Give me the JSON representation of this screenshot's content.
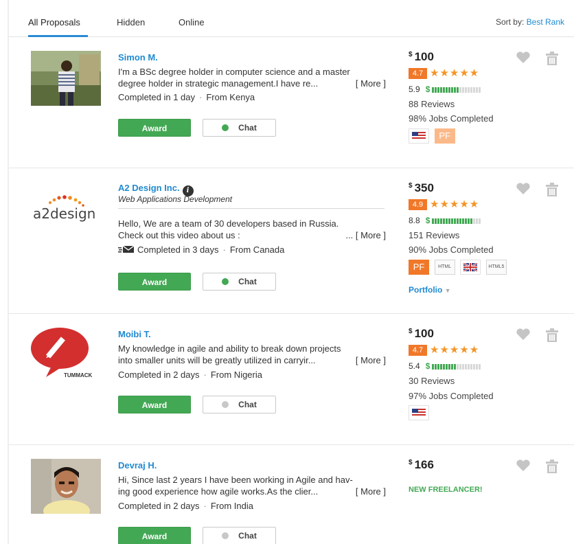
{
  "tabs": [
    {
      "label": "All Proposals",
      "active": true
    },
    {
      "label": "Hidden",
      "active": false
    },
    {
      "label": "Online",
      "active": false
    }
  ],
  "sort": {
    "label": "Sort by:",
    "value": "Best Rank"
  },
  "buttons": {
    "award": "Award",
    "chat": "Chat",
    "more": "[ More ]"
  },
  "proposals": [
    {
      "name": "Simon M.",
      "desc1": "I'm a BSc degree holder in computer science and a master",
      "desc2": "degree holder in strategic management.I have re...",
      "completed": "Completed in 1 day",
      "from": "From Kenya",
      "currency": "$",
      "price": "100",
      "rating": "4.7",
      "earnings": "5.9",
      "earnings_level": 0.55,
      "reviews": "88 Reviews",
      "jobs": "98% Jobs Completed",
      "badges": [
        "us-flag",
        "PF"
      ],
      "chat_online": true
    },
    {
      "name": "A2 Design Inc.",
      "verified_icon": "verified-badge-icon",
      "verified_glyph": "i",
      "subtitle": "Web Applications Development",
      "desc1": "Hello, We are a team of 30 developers based in Russia.",
      "desc2": "Check out this video about us :",
      "desc2_suffix": "...",
      "completed": "Completed in 3 days",
      "from": "From Canada",
      "currency": "$",
      "price": "350",
      "rating": "4.9",
      "earnings": "8.8",
      "earnings_level": 0.85,
      "reviews": "151 Reviews",
      "jobs": "90% Jobs Completed",
      "badges": [
        "PF",
        "HTML",
        "uk-flag",
        "HTML5"
      ],
      "portfolio": "Portfolio",
      "chat_online": true
    },
    {
      "name": "Moibi T.",
      "desc1": "My knowledge in agile and ability to break down projects",
      "desc2": "into smaller units will be greatly utilized in carryir...",
      "completed": "Completed in 2 days",
      "from": "From Nigeria",
      "currency": "$",
      "price": "100",
      "rating": "4.7",
      "earnings": "5.4",
      "earnings_level": 0.5,
      "reviews": "30 Reviews",
      "jobs": "97% Jobs Completed",
      "badges": [
        "us-flag"
      ],
      "logo_text": "TUMMACK",
      "chat_online": false
    },
    {
      "name": "Devraj H.",
      "desc1": "Hi, Since last 2 years I have been working in Agile and hav-",
      "desc2": "ing good experience how agile works.As the clier...",
      "completed": "Completed in 2 days",
      "from": "From India",
      "currency": "$",
      "price": "166",
      "new_freelancer": "NEW FREELANCER!",
      "chat_online": false
    }
  ],
  "badge_labels": {
    "pf": "PF",
    "html": "HTML",
    "html5": "HTML5"
  },
  "logos": {
    "a2design": "a2design"
  },
  "colors": {
    "accent": "#1f8ad0",
    "award": "#43a854",
    "rating": "#f07828",
    "stars": "#f59425",
    "online": "#43a854",
    "offline": "#c8c8c8"
  }
}
